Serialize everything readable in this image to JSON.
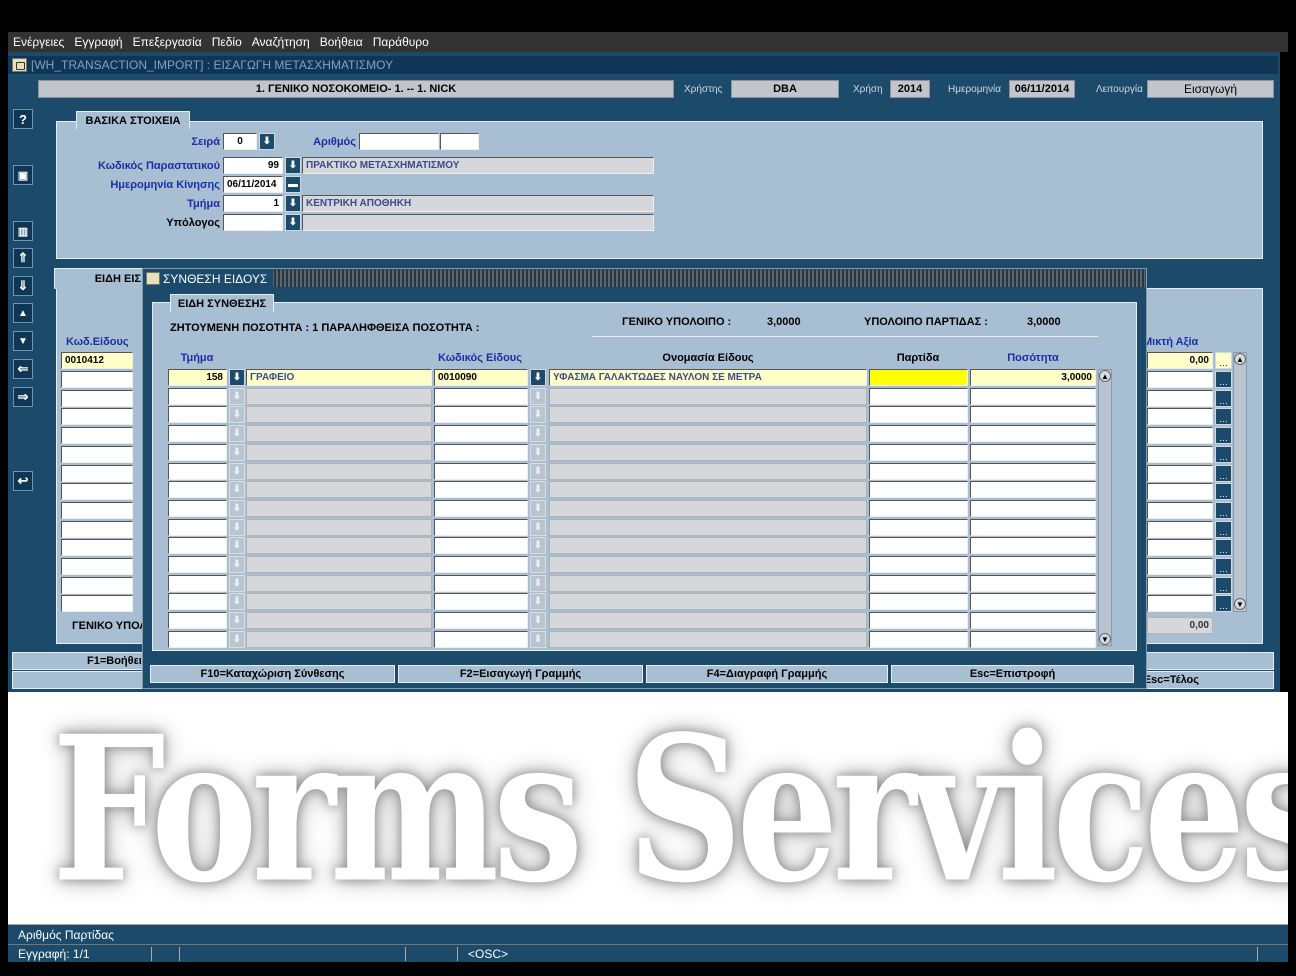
{
  "menu": [
    "Ενέργειες",
    "Εγγραφή",
    "Επεξεργασία",
    "Πεδίο",
    "Αναζήτηση",
    "Βοήθεια",
    "Παράθυρο"
  ],
  "window": {
    "title": "[WH_TRANSACTION_IMPORT] : ΕΙΣΑΓΩΓΗ ΜΕΤΑΣΧΗΜΑΤΙΣΜΟΥ"
  },
  "header": {
    "hospital": "1. ΓΕΝΙΚΟ ΝΟΣΟΚΟΜΕΙΟ- 1. -- 1. NICK",
    "user_label": "Χρήστης",
    "user": "DBA",
    "year_label": "Χρήση",
    "year": "2014",
    "date_label": "Ημερομηνία",
    "date": "06/11/2014",
    "function_label": "Λειτουργία",
    "function": "Εισαγωγή"
  },
  "toolbar": [
    "?",
    "💾",
    "🗑",
    "⬆",
    "⬇",
    "⏶",
    "⏷",
    "⬅",
    "➡",
    "⮌"
  ],
  "basic": {
    "tab": "ΒΑΣΙΚΑ ΣΤΟΙΧΕΙΑ",
    "series_label": "Σειρά",
    "series": "0",
    "number_label": "Αριθμός",
    "number": "",
    "number2": "",
    "doc_code_label": "Κωδικός Παραστατικού",
    "doc_code": "99",
    "doc_name": "ΠΡΑΚΤΙΚΟ ΜΕΤΑΣΧΗΜΑΤΙΣΜΟΥ",
    "move_date_label": "Ημερομηνία Κίνησης",
    "move_date": "06/11/2014",
    "dept_label": "Τμήμα",
    "dept": "1",
    "dept_name": "ΚΕΝΤΡΙΚΗ ΑΠΟΘΗΚΗ",
    "accountable_label": "Υπόλογος",
    "accountable": "",
    "accountable_name": ""
  },
  "items": {
    "tab": "ΕΙΔΗ ΕΙΣ",
    "code_header": "Κωδ.Είδους",
    "value_header": "Μικτή Αξία",
    "first_code": "0010412",
    "first_value": "0,00",
    "total_label": "ΓΕΝΙΚΟ ΥΠΟΛ",
    "total_value": "0,00"
  },
  "fkeys": {
    "f1": "F1=Βοήθει",
    "esc": "Esc=Τέλος"
  },
  "dialog": {
    "title": "ΣΥΝΘΕΣΗ ΕΙΔΟΥΣ",
    "tab": "ΕΙΔΗ ΣΥΝΘΕΣΗΣ",
    "qty_text": "ΖΗΤΟΥΜΕΝΗ ΠΟΣΟΤΗΤΑ : 1 ΠΑΡΑΛΗΦΘΕΙΣΑ ΠΟΣΟΤΗΤΑ :",
    "general_balance_label": "ΓΕΝΙΚΟ ΥΠΟΛΟΙΠΟ :",
    "general_balance": "3,0000",
    "batch_balance_label": "ΥΠΟΛΟΙΠΟ ΠΑΡΤΙΔΑΣ :",
    "batch_balance": "3,0000",
    "columns": {
      "dept": "Τμήμα",
      "code": "Κωδικός Είδους",
      "name": "Ονομασία Είδους",
      "batch": "Παρτίδα",
      "qty": "Ποσότητα"
    },
    "row1": {
      "dept": "158",
      "dept_name": "ΓΡΑΦΕΙΟ",
      "code": "0010090",
      "name": "ΥΦΑΣΜΑ ΓΑΛΑΚΤΩΔΕΣ ΝΑΥΛΟΝ ΣΕ ΜΕΤΡΑ",
      "batch": "",
      "qty": "3,0000"
    },
    "buttons": [
      "F10=Καταχώριση Σύνθεσης",
      "F2=Εισαγωγή Γραμμής",
      "F4=Διαγραφή Γραμμής",
      "Esc=Επιστροφή"
    ]
  },
  "watermark": "Forms Services",
  "status": {
    "hint": "Αριθμός Παρτίδας",
    "record": "Εγγραφή: 1/1",
    "osc": "<OSC>"
  }
}
